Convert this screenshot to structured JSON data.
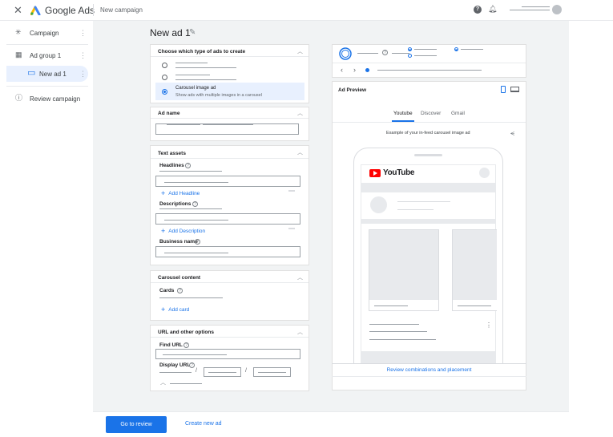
{
  "app": {
    "brand": "Google Ads",
    "breadcrumb": "New campaign"
  },
  "icons": {
    "close": "close-icon",
    "help": "help-icon",
    "bell": "bell-icon",
    "pencil": "pencil-icon"
  },
  "sidebar": {
    "items": [
      {
        "label": "Campaign",
        "icon": "asterisk-icon"
      },
      {
        "label": "Ad group 1",
        "icon": "grid-icon"
      },
      {
        "label": "New ad 1",
        "icon": "display-icon"
      },
      {
        "label": "Review campaign",
        "icon": "info-icon"
      }
    ]
  },
  "page": {
    "title": "New ad 1"
  },
  "ad_type": {
    "header": "Choose which type of ads to create",
    "selected_title": "Carousel image ad",
    "selected_desc": "Show ads with multiple images in a carousel"
  },
  "ad_name": {
    "header": "Ad name"
  },
  "text_assets": {
    "header": "Text assets",
    "headlines_label": "Headlines",
    "add_headline": "Add Headline",
    "descriptions_label": "Descriptions",
    "add_description": "Add Description",
    "business_name_label": "Business name"
  },
  "carousel": {
    "header": "Carousel content",
    "cards_label": "Cards",
    "add_card": "Add card"
  },
  "url": {
    "header": "URL and other options",
    "final_url_label": "Find URL",
    "display_url_label": "Display URL",
    "sep1": "/",
    "sep2": "/"
  },
  "preview": {
    "header": "Ad Preview",
    "tabs": [
      "Youtube",
      "Discover",
      "Gmail"
    ],
    "active_tab": "Youtube",
    "example_text": "Example of your in-feed carousel image ad",
    "yt_text": "YouTube",
    "review_link": "Review combinations and placement"
  },
  "footer": {
    "primary": "Go to review",
    "secondary": "Create new ad"
  },
  "colors": {
    "accent": "#1a73e8",
    "youtube_red": "#ff0000",
    "background": "#f1f3f4"
  }
}
